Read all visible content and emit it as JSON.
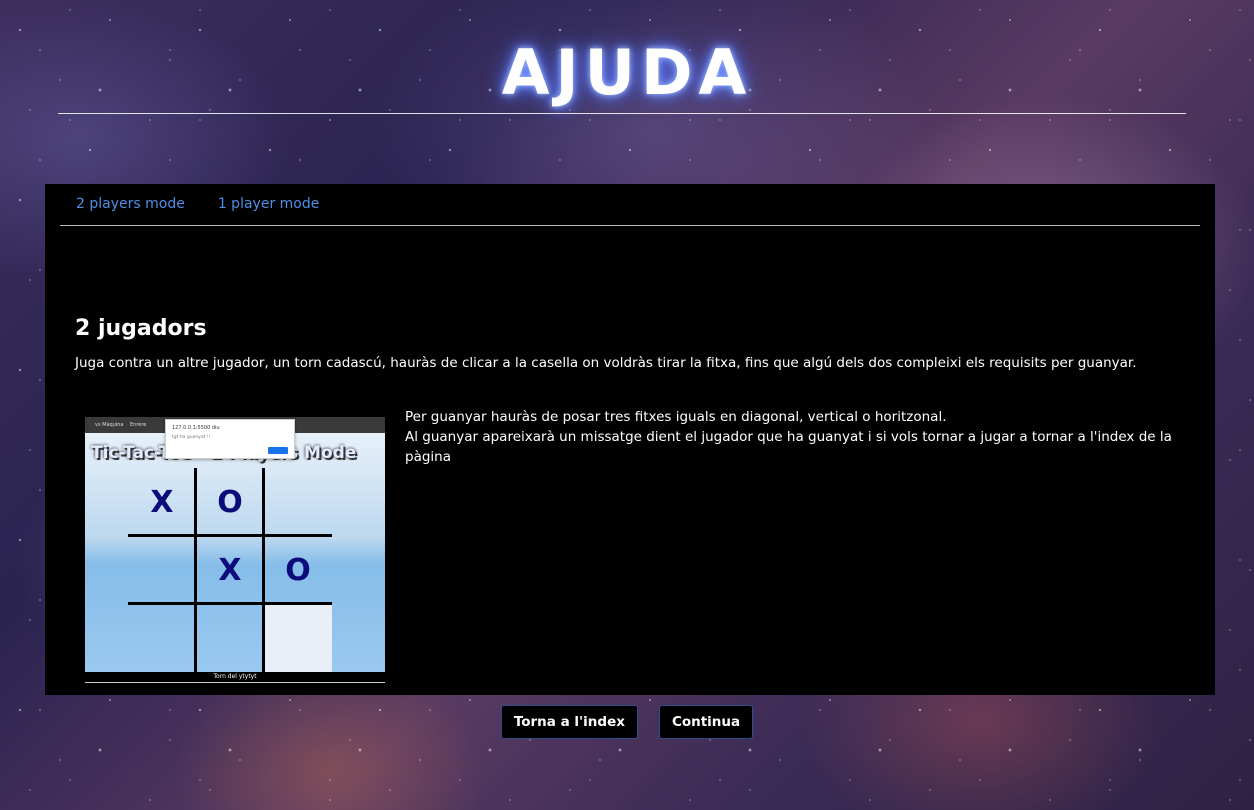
{
  "page": {
    "title": "AJUDA"
  },
  "tabs": [
    {
      "label": "2 players mode"
    },
    {
      "label": "1 player mode"
    }
  ],
  "section": {
    "title": "2 jugadors",
    "description": "Juga contra un altre jugador, un torn cadascú, hauràs de clicar a la casella on voldràs tirar la fitxa, fins que algú dels dos compleixi els requisits per guanyar."
  },
  "screenshot": {
    "tabs": [
      "vs Màquina",
      "Enrere"
    ],
    "dialog_host": "127.0.0.1:5500 diu",
    "dialog_message": "tgt ha guanyat !!",
    "heading": "Tic-Tac-Toe - 2 Players Mode",
    "board": [
      "X",
      "O",
      "",
      "",
      "X",
      "O",
      "",
      "",
      ""
    ],
    "footer": "Torn del ytytyt"
  },
  "win_text": {
    "line1": "Per guanyar hauràs de posar tres fitxes iguals en diagonal, vertical o horitzonal.",
    "line2": "Al guanyar apareixarà un missatge dient el jugador que ha guanyat i si vols tornar a jugar a tornar a l'index de la pàgina"
  },
  "buttons": {
    "back_label": "Torna a l'index",
    "continue_label": "Continua"
  }
}
